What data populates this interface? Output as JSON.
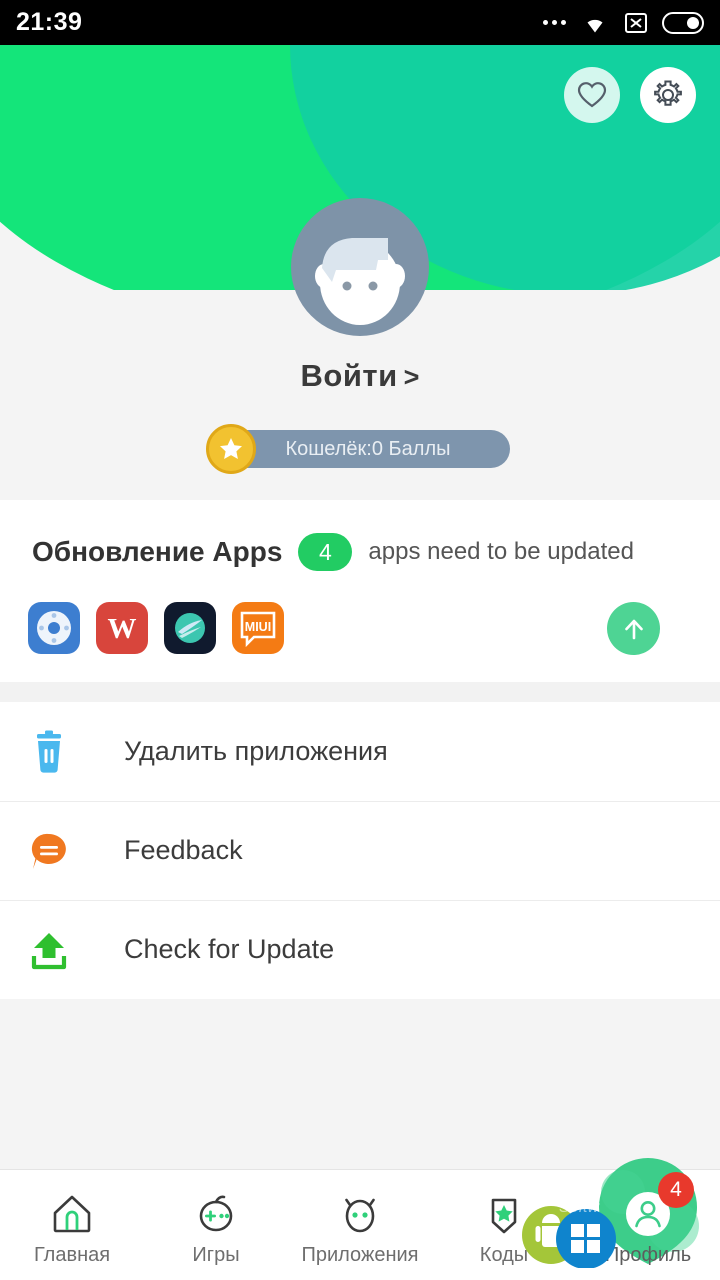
{
  "status_bar": {
    "time": "21:39",
    "icons": [
      "more-dots-icon",
      "wifi-icon",
      "no-signal-icon",
      "battery-icon"
    ]
  },
  "header": {
    "background_color": "#14e57a",
    "blob_color": "#12cfa2",
    "favorite_label": "heart-icon",
    "settings_label": "gear-icon"
  },
  "profile": {
    "avatar_alt": "default-user-avatar",
    "login_text": "Войти",
    "login_caret": ">",
    "wallet_text": "Кошелёк:0 Баллы",
    "wallet_color": "#7e95ad",
    "coin_color": "#f2c230"
  },
  "update_card": {
    "title": "Обновление Apps",
    "badge_count": "4",
    "badge_color": "#22cc63",
    "subtitle": "apps need to be updated",
    "update_all_label": "update-all",
    "apps": [
      {
        "name": "Mi Remote",
        "glyph": "◉",
        "bg": "#3d7ed0",
        "fg": "#ffffff"
      },
      {
        "name": "WPS Office",
        "glyph": "W",
        "bg": "#d8453c",
        "fg": "#ffffff"
      },
      {
        "name": "SwiftKey",
        "glyph": "◗",
        "bg": "#101a2e",
        "fg": "#3fc6b7"
      },
      {
        "name": "MIUI",
        "glyph": "MIUI",
        "bg": "#f47b14",
        "fg": "#ffffff"
      }
    ]
  },
  "menu": {
    "items": [
      {
        "label": "Удалить приложения",
        "icon": "trash-icon",
        "color": "#4ab8ee"
      },
      {
        "label": "Feedback",
        "icon": "chat-bubble-icon",
        "color": "#f07820"
      },
      {
        "label": "Check for Update",
        "icon": "upload-icon",
        "color": "#2fbf2f"
      }
    ]
  },
  "bottom_nav": {
    "items": [
      {
        "label": "Главная",
        "icon": "home-icon",
        "active": false
      },
      {
        "label": "Игры",
        "icon": "gamepad-icon",
        "active": false
      },
      {
        "label": "Приложения",
        "icon": "android-face-icon",
        "active": false
      },
      {
        "label": "Коды",
        "icon": "badge-star-icon",
        "active": false
      },
      {
        "label": "Профиль",
        "icon": "person-icon",
        "active": true,
        "badge": "4"
      }
    ],
    "active_color": "#2fd07a"
  },
  "watermark": {
    "text": "Softw",
    "icons": [
      "android-logo",
      "windows-logo"
    ]
  }
}
